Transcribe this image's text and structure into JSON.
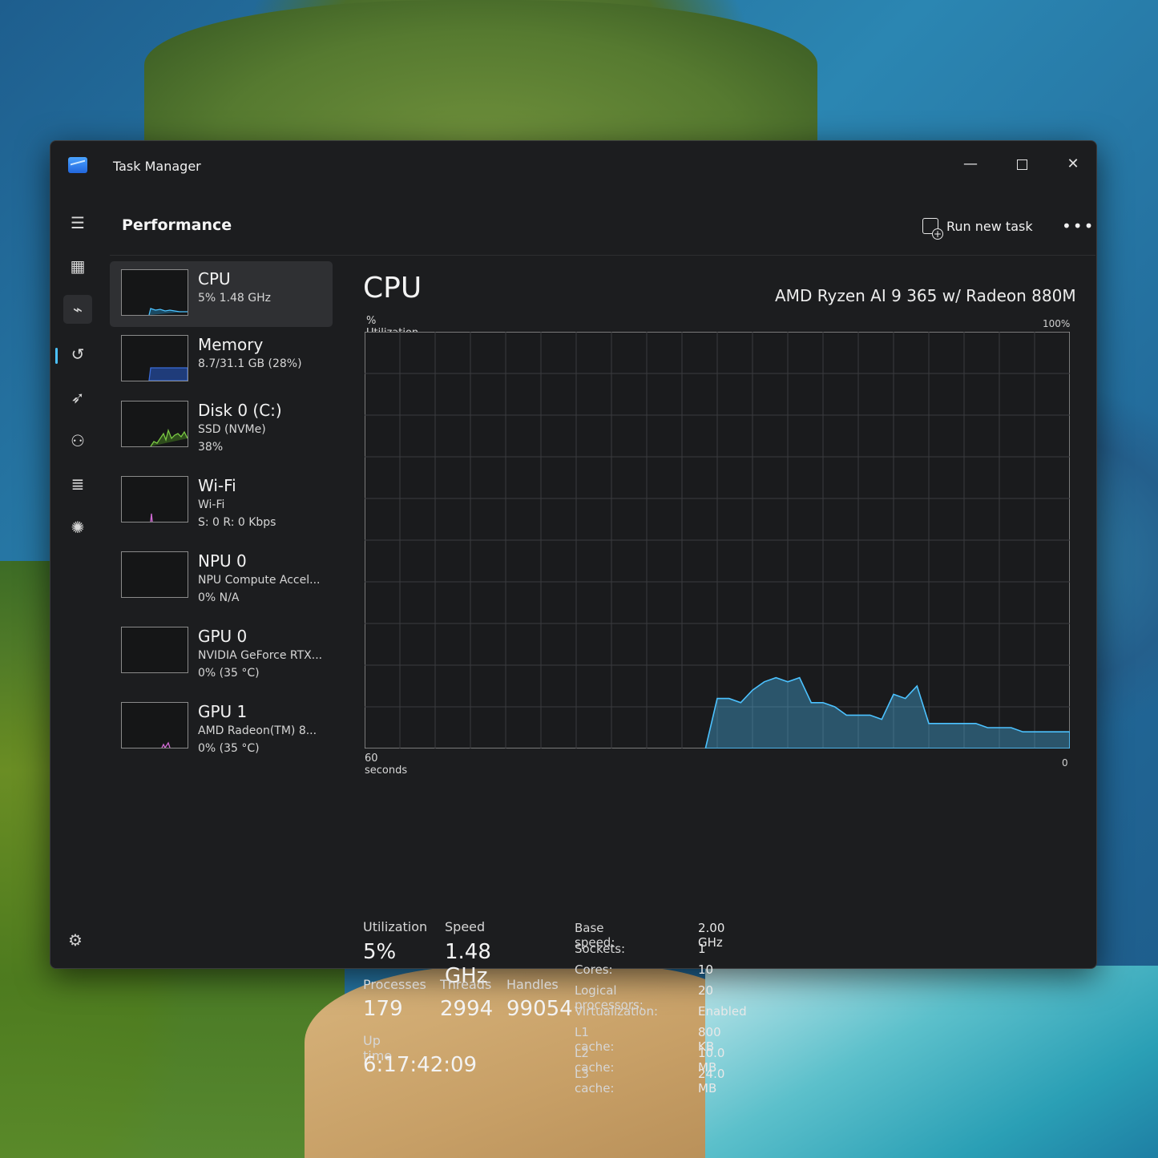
{
  "window": {
    "title": "Task Manager"
  },
  "nav": {
    "icons": [
      "hamburger-menu-icon",
      "processes-icon",
      "performance-icon",
      "app-history-icon",
      "startup-apps-icon",
      "users-icon",
      "details-icon",
      "services-icon",
      "settings-icon"
    ]
  },
  "header": {
    "title": "Performance",
    "run_new_task": "Run new task",
    "more": "•••"
  },
  "sidebar": {
    "items": [
      {
        "name": "CPU",
        "sub1": "5%  1.48 GHz",
        "sub2": "",
        "color": "#4cc2ff"
      },
      {
        "name": "Memory",
        "sub1": "8.7/31.1 GB (28%)",
        "sub2": "",
        "color": "#3b6cd8"
      },
      {
        "name": "Disk 0 (C:)",
        "sub1": "SSD (NVMe)",
        "sub2": "38%",
        "color": "#7ac943"
      },
      {
        "name": "Wi-Fi",
        "sub1": "Wi-Fi",
        "sub2": "S: 0  R: 0 Kbps",
        "color": "#d26bd6"
      },
      {
        "name": "NPU 0",
        "sub1": "NPU Compute Accel...",
        "sub2": "0%  N/A",
        "color": "#4cc2ff"
      },
      {
        "name": "GPU 0",
        "sub1": "NVIDIA GeForce RTX...",
        "sub2": "0%  (35 °C)",
        "color": "#d26bd6"
      },
      {
        "name": "GPU 1",
        "sub1": "AMD Radeon(TM) 8...",
        "sub2": "0%  (35 °C)",
        "color": "#d26bd6"
      }
    ]
  },
  "main": {
    "title": "CPU",
    "model": "AMD Ryzen AI 9 365 w/ Radeon 880M",
    "util_label": "% Utilization",
    "max_label": "100%",
    "time_label": "60 seconds",
    "min_label": "0",
    "stats": {
      "utilization_label": "Utilization",
      "utilization": "5%",
      "speed_label": "Speed",
      "speed": "1.48 GHz",
      "processes_label": "Processes",
      "processes": "179",
      "threads_label": "Threads",
      "threads": "2994",
      "handles_label": "Handles",
      "handles": "99054",
      "uptime_label": "Up time",
      "uptime": "6:17:42:09"
    },
    "specs": [
      {
        "label": "Base speed:",
        "value": "2.00 GHz"
      },
      {
        "label": "Sockets:",
        "value": "1"
      },
      {
        "label": "Cores:",
        "value": "10"
      },
      {
        "label": "Logical processors:",
        "value": "20"
      },
      {
        "label": "Virtualization:",
        "value": "Enabled"
      },
      {
        "label": "L1 cache:",
        "value": "800 KB"
      },
      {
        "label": "L2 cache:",
        "value": "10.0 MB"
      },
      {
        "label": "L3 cache:",
        "value": "24.0 MB"
      }
    ]
  },
  "chart_data": {
    "type": "area",
    "ylim": [
      0,
      100
    ],
    "xlim": [
      0,
      60
    ],
    "x": [
      29,
      30,
      31,
      32,
      33,
      34,
      35,
      36,
      37,
      38,
      39,
      40,
      41,
      42,
      43,
      44,
      45,
      46,
      47,
      48,
      49,
      50,
      51,
      52,
      53,
      54,
      55,
      56,
      57,
      58,
      59,
      60
    ],
    "values": [
      0,
      12,
      12,
      11,
      14,
      16,
      17,
      16,
      17,
      11,
      11,
      10,
      8,
      8,
      8,
      7,
      13,
      12,
      15,
      6,
      6,
      6,
      6,
      6,
      5,
      5,
      5,
      4,
      4,
      4,
      4,
      4
    ],
    "grid": true,
    "color": "#4cc2ff"
  }
}
